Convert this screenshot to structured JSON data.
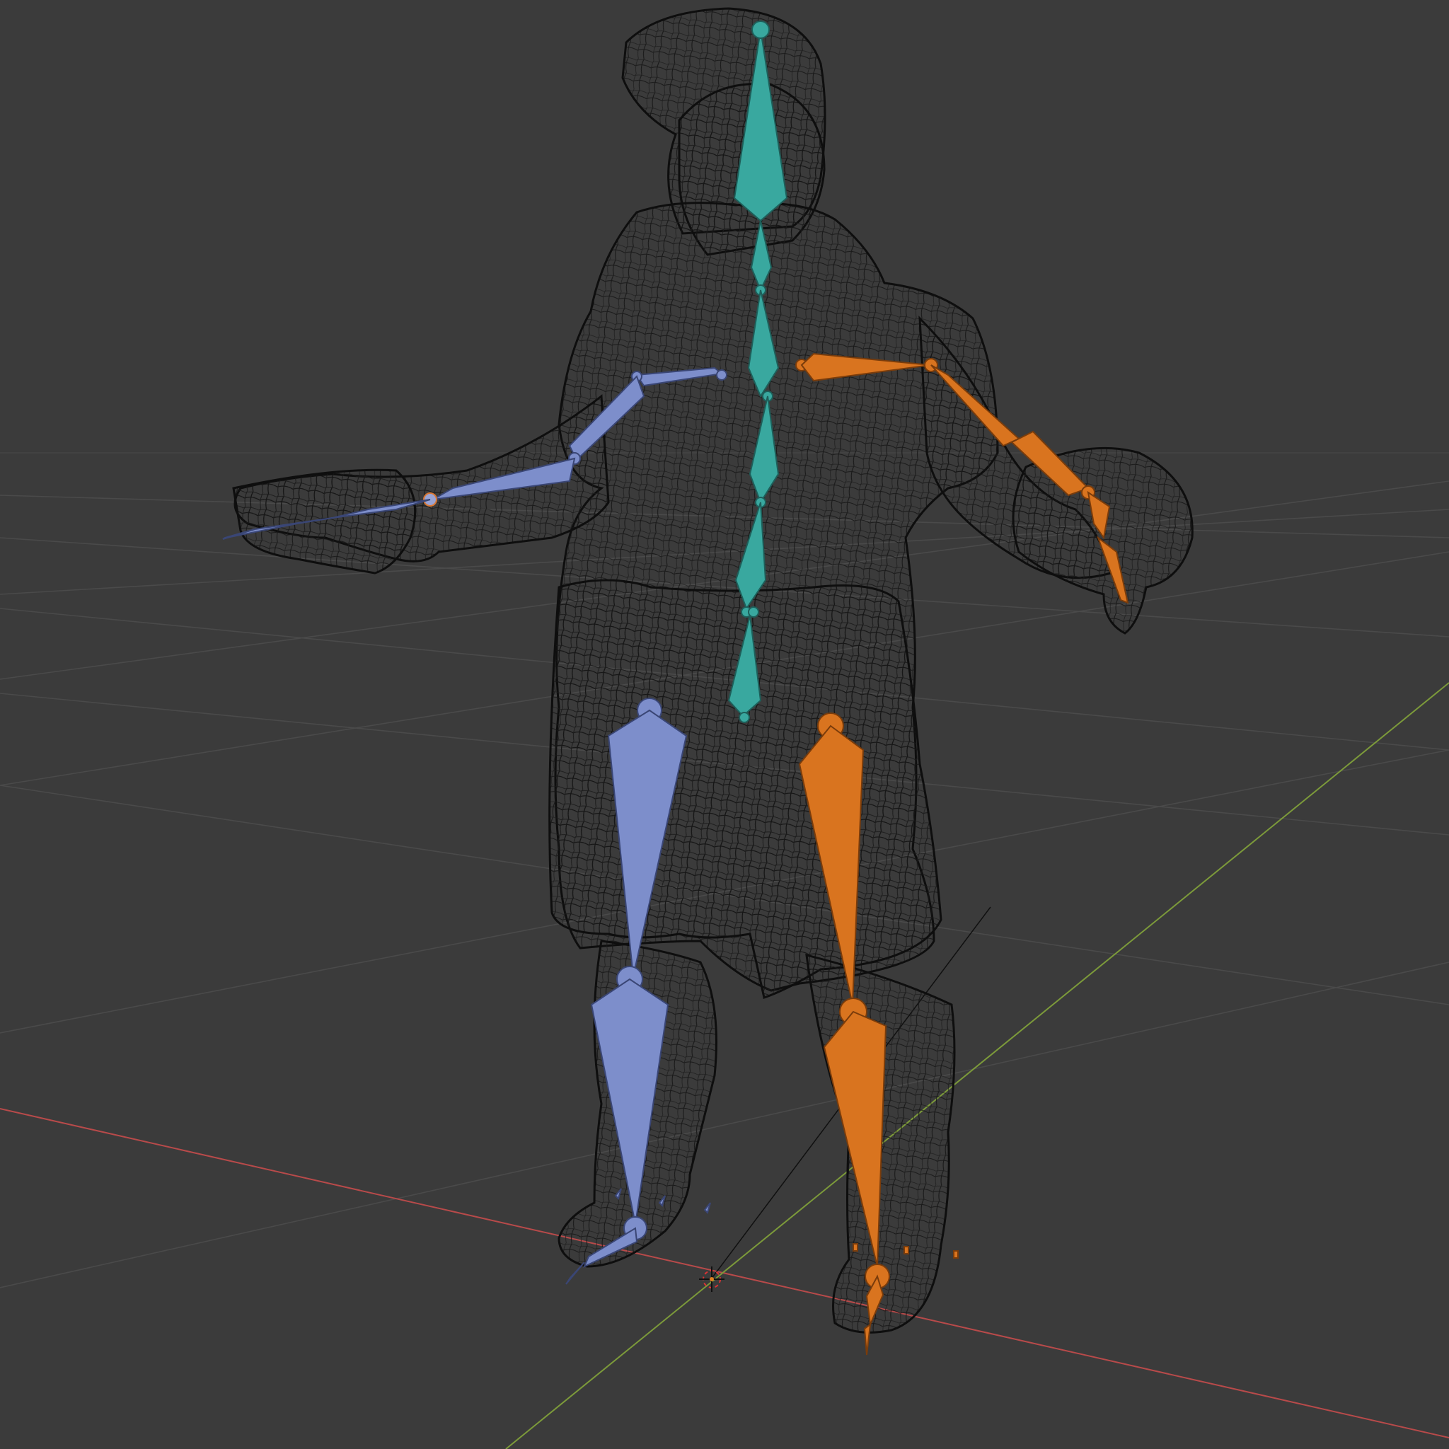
{
  "viewport": {
    "background": "#3b3b3b",
    "grid_color": "#454545",
    "x_axis_color": "#b84a4a",
    "y_axis_color": "#7c9a3a",
    "wireframe_color": "#121212"
  },
  "armature": {
    "spine_color": "#39a89f",
    "left_side_color": "#7d8ecb",
    "right_side_color": "#d9741f",
    "bones": {
      "spine": [
        "head",
        "neck",
        "chest",
        "spine-upper",
        "spine-mid",
        "spine-lower",
        "hips"
      ],
      "left": [
        "shoulder-l",
        "upper-arm-l",
        "forearm-l",
        "hand-l",
        "fingers-l",
        "thigh-l",
        "shin-l",
        "foot-l",
        "toe-l"
      ],
      "right": [
        "shoulder-r",
        "upper-arm-r",
        "forearm-r",
        "hand-r",
        "fingers-r",
        "thigh-r",
        "shin-r",
        "foot-r",
        "toe-r"
      ]
    }
  },
  "icons": [
    "3d-cursor-icon"
  ]
}
